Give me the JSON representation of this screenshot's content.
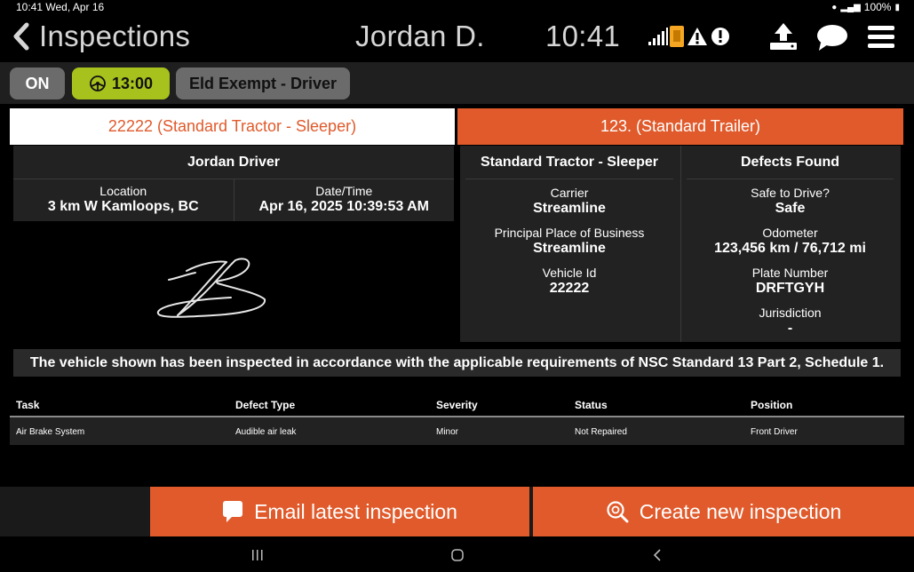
{
  "status_bar": {
    "time_date": "10:41  Wed, Apr 16",
    "battery": "100%"
  },
  "header": {
    "title": "Inspections",
    "driver": "Jordan D.",
    "clock": "10:41"
  },
  "duty": {
    "status": "ON",
    "timer": "13:00",
    "exemption": "Eld Exempt - Driver"
  },
  "tabs": {
    "tractor": "22222 (Standard Tractor - Sleeper)",
    "trailer": "123. (Standard Trailer)"
  },
  "driver_panel": {
    "name": "Jordan Driver",
    "location_label": "Location",
    "location_value": "3 km W Kamloops, BC",
    "datetime_label": "Date/Time",
    "datetime_value": "Apr 16, 2025 10:39:53 AM"
  },
  "vehicle_info": {
    "col1_title": "Standard Tractor - Sleeper",
    "col2_title": "Defects Found",
    "carrier_label": "Carrier",
    "carrier_value": "Streamline",
    "ppb_label": "Principal Place of Business",
    "ppb_value": "Streamline",
    "vehicle_id_label": "Vehicle Id",
    "vehicle_id_value": "22222",
    "safe_label": "Safe to Drive?",
    "safe_value": "Safe",
    "odometer_label": "Odometer",
    "odometer_value": "123,456 km / 76,712 mi",
    "plate_label": "Plate Number",
    "plate_value": "DRFTGYH",
    "jurisdiction_label": "Jurisdiction",
    "jurisdiction_value": "-"
  },
  "banner": "The vehicle shown has been inspected in accordance with the applicable requirements of NSC Standard 13 Part 2, Schedule 1.",
  "defects_table": {
    "headers": [
      "Task",
      "Defect Type",
      "Severity",
      "Status",
      "Position"
    ],
    "rows": [
      [
        "Air Brake System",
        "Audible air leak",
        "Minor",
        "Not Repaired",
        "Front Driver"
      ]
    ]
  },
  "actions": {
    "email": "Email latest inspection",
    "create": "Create new inspection"
  },
  "colors": {
    "accent": "#e05a2b",
    "timer": "#a7c21c",
    "panel": "#222222",
    "warning": "#f5a623"
  },
  "icons": [
    "chevron-left-icon",
    "signal-icon",
    "sim-icon",
    "warning-icon",
    "alert-icon",
    "upload-icon",
    "chat-icon",
    "menu-icon",
    "steering-wheel-icon",
    "comment-icon",
    "search-inspection-icon"
  ]
}
